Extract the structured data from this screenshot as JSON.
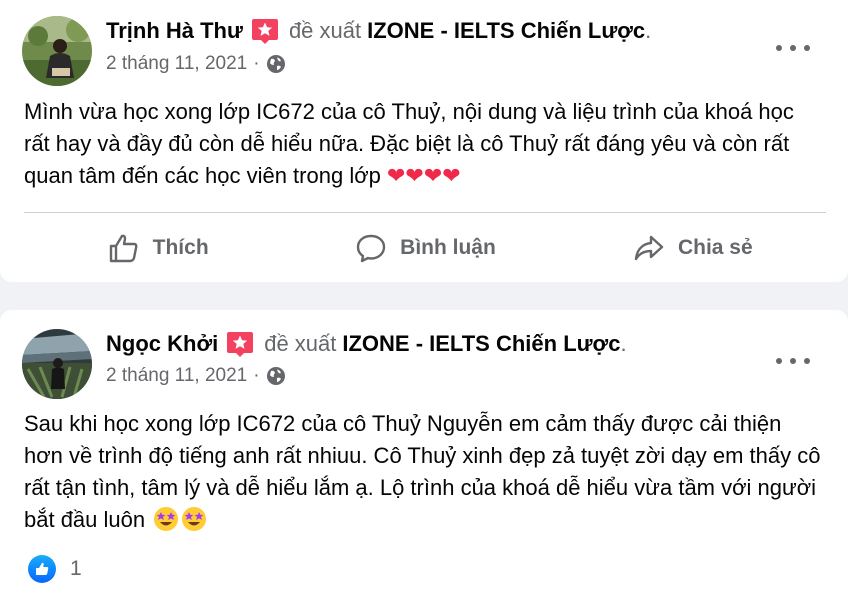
{
  "posts": [
    {
      "author": "Trịnh Hà Thư",
      "verb": "đề xuất",
      "page": "IZONE - IELTS Chiến Lược",
      "period": ".",
      "date": "2 tháng 11, 2021",
      "dot": "·",
      "text": "Mình vừa học xong lớp IC672 của cô Thuỷ, nội dung và liệu trình của khoá học rất hay và đầy đủ còn dễ hiểu nữa. Đặc biệt là cô Thuỷ rất đáng yêu và còn rất quan tâm đến các học viên trong lớp",
      "emoji": "❤❤❤❤",
      "actions": {
        "like": "Thích",
        "comment": "Bình luận",
        "share": "Chia sẻ"
      }
    },
    {
      "author": "Ngọc Khởi",
      "verb": "đề xuất",
      "page": "IZONE - IELTS Chiến Lược",
      "period": ".",
      "date": "2 tháng 11, 2021",
      "dot": "·",
      "text": "Sau khi học xong lớp IC672 của cô Thuỷ Nguyễn em cảm thấy được cải thiện hơn về trình độ tiếng anh rất nhiuu. Cô Thuỷ xinh đẹp zả tuyệt zời dạy em thấy cô rất tận tình, tâm lý và dễ hiểu lắm ạ. Lộ trình của khoá dễ hiểu vừa tầm với người bắt đầu luôn",
      "reaction_count": "1"
    }
  ],
  "icons": {
    "recommend": "red-star-badge",
    "audience": "globe-icon",
    "more": "ellipsis-icon",
    "like": "thumbs-up-icon",
    "comment": "speech-bubble-icon",
    "share": "share-arrow-icon",
    "reaction": "blue-like-badge",
    "emoji": "star-struck-emoji"
  },
  "colors": {
    "secondary_text": "#65676b",
    "badge_red": "#f3425f",
    "like_blue": "#0866ff",
    "heart": "#f02849",
    "background": "#f0f2f5"
  }
}
